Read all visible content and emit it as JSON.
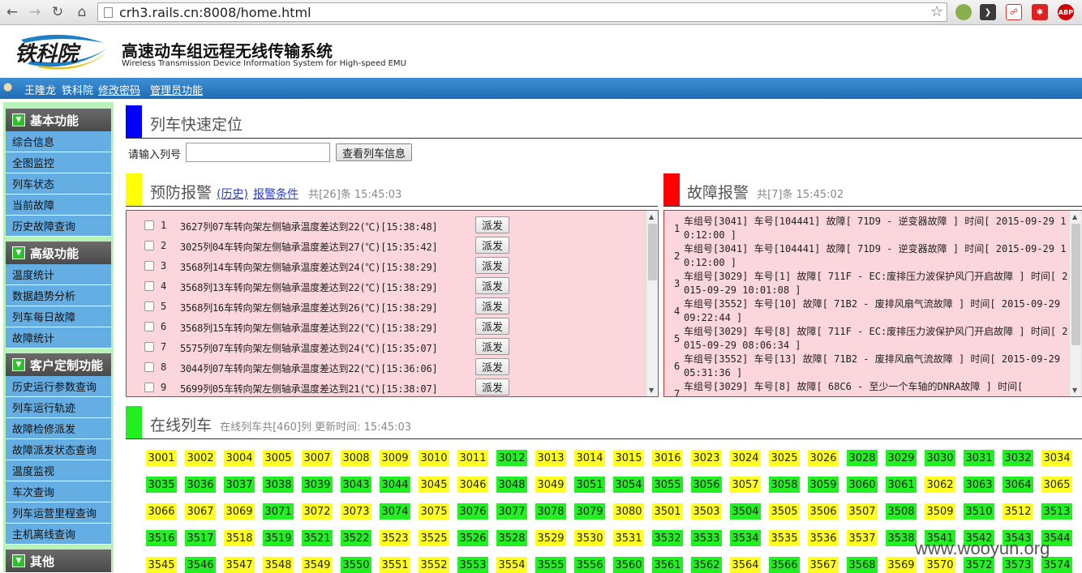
{
  "browser": {
    "url": "crh3.rails.cn:8008/home.html"
  },
  "header": {
    "logo_text": "铁科院",
    "title": "高速动车组远程无线传输系统",
    "subtitle": "Wireless Transmission Device Information System for High-speed EMU"
  },
  "user_bar": {
    "user_name": "王隆龙",
    "org": "铁科院",
    "change_password": "修改密码",
    "admin": "管理员功能"
  },
  "sidebar": {
    "groups": [
      {
        "title": "基本功能",
        "items": [
          "综合信息",
          "全图监控",
          "列车状态",
          "当前故障",
          "历史故障查询"
        ]
      },
      {
        "title": "高级功能",
        "items": [
          "温度统计",
          "数据趋势分析",
          "列车每日故障",
          "故障统计"
        ]
      },
      {
        "title": "客户定制功能",
        "items": [
          "历史运行参数查询",
          "列车运行轨迹",
          "故障检修派发",
          "故障派发状态查询",
          "温度监视",
          "车次查询",
          "列车运营里程查询",
          "主机离线查询"
        ]
      },
      {
        "title": "其他",
        "items": []
      }
    ]
  },
  "locate": {
    "title": "列车快速定位",
    "input_label": "请输入列号",
    "input_value": "",
    "button": "查看列车信息"
  },
  "prevention": {
    "title": "预防报警",
    "history_link": "(历史)",
    "conditions_link": "报警条件",
    "count": "共[26]条 15:45:03",
    "dispatch_label": "派发",
    "rows": [
      {
        "num": "1",
        "text": "3627列07车转向架左侧轴承温度差达到22(℃)[15:38:48]"
      },
      {
        "num": "2",
        "text": "3025列04车转向架左侧轴承温度差达到27(℃)[15:35:42]"
      },
      {
        "num": "3",
        "text": "3568列14车转向架左侧轴承温度差达到24(℃)[15:38:29]"
      },
      {
        "num": "4",
        "text": "3568列13车转向架左侧轴承温度差达到22(℃)[15:38:29]"
      },
      {
        "num": "5",
        "text": "3568列16车转向架左侧轴承温度差达到26(℃)[15:38:29]"
      },
      {
        "num": "6",
        "text": "3568列15车转向架左侧轴承温度差达到22(℃)[15:38:29]"
      },
      {
        "num": "7",
        "text": "5575列07车转向架左侧轴承温度差达到24(℃)[15:35:07]"
      },
      {
        "num": "8",
        "text": "3044列07车转向架左侧轴承温度差达到22(℃)[15:36:06]"
      },
      {
        "num": "9",
        "text": "5699列05车转向架左侧轴承温度差达到21(℃)[15:38:07]"
      }
    ]
  },
  "faults": {
    "title": "故障报警",
    "count": "共[7]条 15:45:02",
    "rows": [
      {
        "num": "1",
        "text": "车组号[3041] 车号[104441] 故障[ 71D9 - 逆变器故障 ] 时间[ 2015-09-29 10:12:00 ]"
      },
      {
        "num": "2",
        "text": "车组号[3041] 车号[104441] 故障[ 71D9 - 逆变器故障 ] 时间[ 2015-09-29 10:12:00 ]"
      },
      {
        "num": "3",
        "text": "车组号[3029] 车号[1] 故障[ 711F - EC:废排压力波保护风门开启故障 ] 时间[ 2015-09-29 10:01:08 ]"
      },
      {
        "num": "4",
        "text": "车组号[3552] 车号[10] 故障[ 71B2 - 废排风扇气流故障 ] 时间[ 2015-09-29 09:22:44 ]"
      },
      {
        "num": "5",
        "text": "车组号[3029] 车号[8] 故障[ 711F - EC:废排压力波保护风门开启故障 ] 时间[ 2015-09-29 08:06:34 ]"
      },
      {
        "num": "6",
        "text": "车组号[3552] 车号[13] 故障[ 71B2 - 废排风扇气流故障 ] 时间[ 2015-09-29 05:31:36 ]"
      },
      {
        "num": "7",
        "text": "车组号[3029] 车号[8] 故障[ 68C6 - 至少一个车轴的DNRA故障 ] 时间["
      }
    ]
  },
  "online": {
    "title": "在线列车",
    "summary": "在线列车共[460]列 更新时间: 15:45:03",
    "colors": {
      "y": "#ffff22",
      "g": "#22f022"
    },
    "trains": [
      [
        "3001",
        "y"
      ],
      [
        "3002",
        "y"
      ],
      [
        "3004",
        "y"
      ],
      [
        "3005",
        "y"
      ],
      [
        "3007",
        "y"
      ],
      [
        "3008",
        "y"
      ],
      [
        "3009",
        "y"
      ],
      [
        "3010",
        "y"
      ],
      [
        "3011",
        "y"
      ],
      [
        "3012",
        "g"
      ],
      [
        "3013",
        "y"
      ],
      [
        "3014",
        "y"
      ],
      [
        "3015",
        "y"
      ],
      [
        "3016",
        "y"
      ],
      [
        "3023",
        "y"
      ],
      [
        "3024",
        "y"
      ],
      [
        "3025",
        "y"
      ],
      [
        "3026",
        "y"
      ],
      [
        "3028",
        "g"
      ],
      [
        "3029",
        "g"
      ],
      [
        "3030",
        "g"
      ],
      [
        "3031",
        "g"
      ],
      [
        "3032",
        "g"
      ],
      [
        "3034",
        "y"
      ],
      [
        "3035",
        "g"
      ],
      [
        "3036",
        "g"
      ],
      [
        "3037",
        "g"
      ],
      [
        "3038",
        "g"
      ],
      [
        "3039",
        "g"
      ],
      [
        "3043",
        "g"
      ],
      [
        "3044",
        "g"
      ],
      [
        "3045",
        "y"
      ],
      [
        "3046",
        "y"
      ],
      [
        "3048",
        "g"
      ],
      [
        "3049",
        "y"
      ],
      [
        "3051",
        "g"
      ],
      [
        "3054",
        "g"
      ],
      [
        "3055",
        "g"
      ],
      [
        "3056",
        "g"
      ],
      [
        "3057",
        "y"
      ],
      [
        "3058",
        "g"
      ],
      [
        "3059",
        "g"
      ],
      [
        "3060",
        "g"
      ],
      [
        "3061",
        "g"
      ],
      [
        "3062",
        "y"
      ],
      [
        "3063",
        "g"
      ],
      [
        "3064",
        "g"
      ],
      [
        "3065",
        "y"
      ],
      [
        "3066",
        "y"
      ],
      [
        "3067",
        "y"
      ],
      [
        "3069",
        "y"
      ],
      [
        "3071",
        "g"
      ],
      [
        "3072",
        "y"
      ],
      [
        "3073",
        "y"
      ],
      [
        "3074",
        "g"
      ],
      [
        "3075",
        "y"
      ],
      [
        "3076",
        "g"
      ],
      [
        "3077",
        "g"
      ],
      [
        "3078",
        "g"
      ],
      [
        "3079",
        "g"
      ],
      [
        "3080",
        "y"
      ],
      [
        "3501",
        "y"
      ],
      [
        "3503",
        "y"
      ],
      [
        "3504",
        "g"
      ],
      [
        "3505",
        "y"
      ],
      [
        "3506",
        "y"
      ],
      [
        "3507",
        "y"
      ],
      [
        "3508",
        "g"
      ],
      [
        "3509",
        "y"
      ],
      [
        "3510",
        "g"
      ],
      [
        "3512",
        "y"
      ],
      [
        "3513",
        "g"
      ],
      [
        "3516",
        "g"
      ],
      [
        "3517",
        "g"
      ],
      [
        "3518",
        "y"
      ],
      [
        "3519",
        "g"
      ],
      [
        "3521",
        "g"
      ],
      [
        "3522",
        "g"
      ],
      [
        "3523",
        "y"
      ],
      [
        "3525",
        "y"
      ],
      [
        "3526",
        "g"
      ],
      [
        "3528",
        "g"
      ],
      [
        "3529",
        "y"
      ],
      [
        "3530",
        "y"
      ],
      [
        "3531",
        "y"
      ],
      [
        "3532",
        "g"
      ],
      [
        "3533",
        "g"
      ],
      [
        "3534",
        "g"
      ],
      [
        "3535",
        "y"
      ],
      [
        "3536",
        "y"
      ],
      [
        "3537",
        "y"
      ],
      [
        "3538",
        "g"
      ],
      [
        "3541",
        "g"
      ],
      [
        "3542",
        "g"
      ],
      [
        "3543",
        "g"
      ],
      [
        "3544",
        "g"
      ],
      [
        "3545",
        "y"
      ],
      [
        "3546",
        "g"
      ],
      [
        "3547",
        "y"
      ],
      [
        "3548",
        "y"
      ],
      [
        "3549",
        "y"
      ],
      [
        "3550",
        "g"
      ],
      [
        "3551",
        "y"
      ],
      [
        "3552",
        "y"
      ],
      [
        "3553",
        "g"
      ],
      [
        "3554",
        "y"
      ],
      [
        "3555",
        "g"
      ],
      [
        "3556",
        "g"
      ],
      [
        "3560",
        "g"
      ],
      [
        "3561",
        "g"
      ],
      [
        "3562",
        "g"
      ],
      [
        "3564",
        "y"
      ],
      [
        "3566",
        "g"
      ],
      [
        "3567",
        "y"
      ],
      [
        "3568",
        "g"
      ],
      [
        "3569",
        "y"
      ],
      [
        "3570",
        "y"
      ],
      [
        "3572",
        "g"
      ],
      [
        "3573",
        "g"
      ],
      [
        "3574",
        "g"
      ]
    ]
  },
  "watermark": "www.wooyun.org"
}
